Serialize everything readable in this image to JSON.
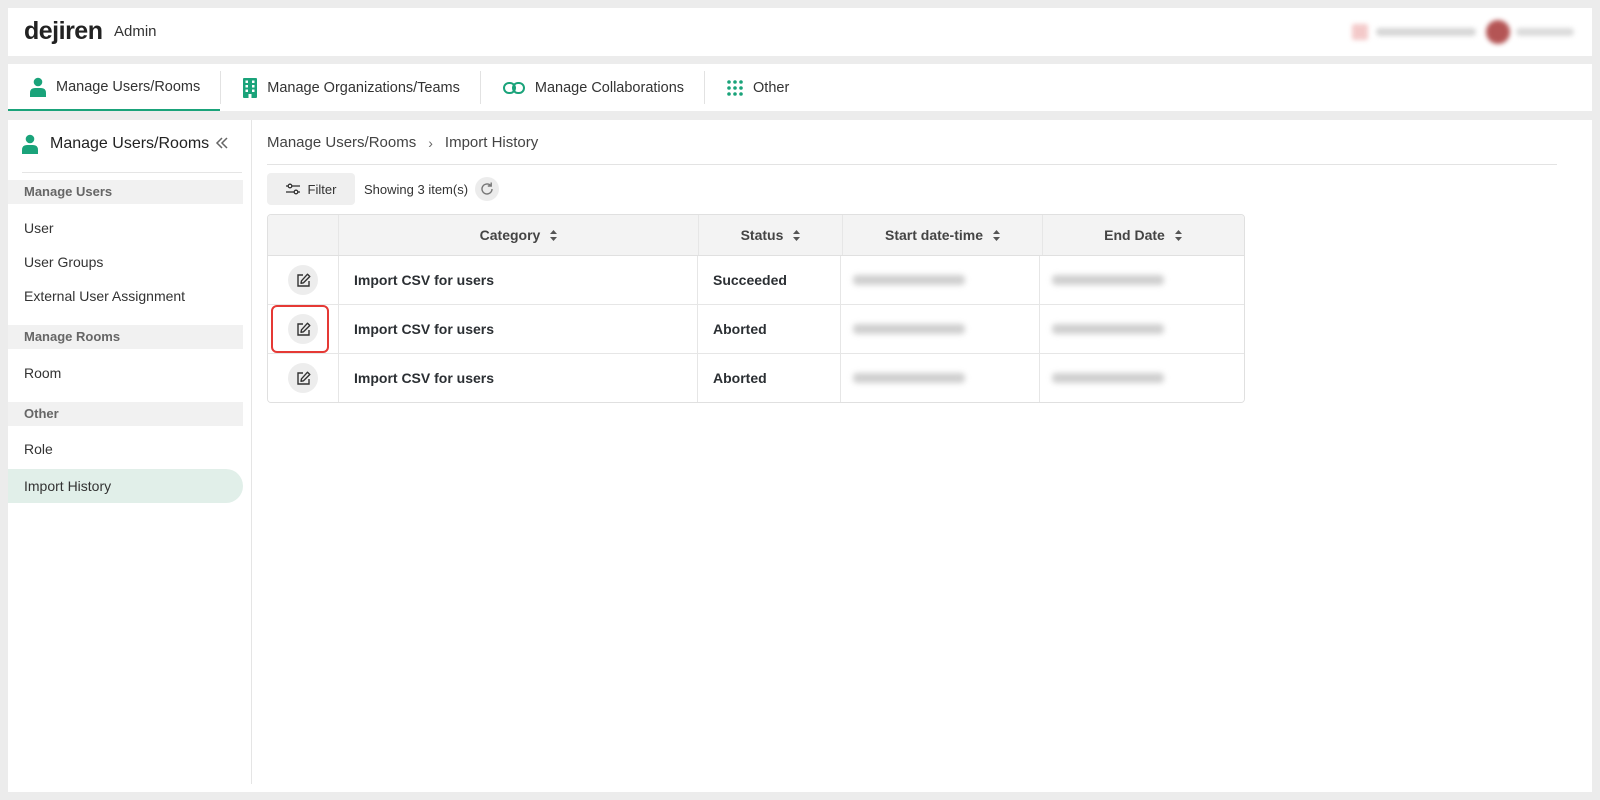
{
  "app": {
    "logo": "dejiren",
    "title": "Admin"
  },
  "nav": {
    "tabs": [
      {
        "label": "Manage Users/Rooms",
        "icon": "person-icon",
        "active": true
      },
      {
        "label": "Manage Organizations/Teams",
        "icon": "building-icon",
        "active": false
      },
      {
        "label": "Manage Collaborations",
        "icon": "link-icon",
        "active": false
      },
      {
        "label": "Other",
        "icon": "grid-icon",
        "active": false
      }
    ]
  },
  "sidebar": {
    "title": "Manage Users/Rooms",
    "sections": [
      {
        "label": "Manage Users",
        "items": [
          "User",
          "User Groups",
          "External User Assignment"
        ]
      },
      {
        "label": "Manage Rooms",
        "items": [
          "Room"
        ]
      },
      {
        "label": "Other",
        "items": [
          "Role",
          "Import History"
        ]
      }
    ],
    "active_item": "Import History"
  },
  "breadcrumb": {
    "parent": "Manage Users/Rooms",
    "current": "Import History"
  },
  "toolbar": {
    "filter_label": "Filter",
    "showing_text": "Showing 3 item(s)"
  },
  "table": {
    "headers": [
      "Category",
      "Status",
      "Start date-time",
      "End Date"
    ],
    "rows": [
      {
        "category": "Import CSV for users",
        "status": "Succeeded"
      },
      {
        "category": "Import CSV for users",
        "status": "Aborted"
      },
      {
        "category": "Import CSV for users",
        "status": "Aborted"
      }
    ]
  },
  "colors": {
    "accent": "#1aa37a",
    "highlight": "#e53935",
    "active_bg": "#e1efe9"
  }
}
